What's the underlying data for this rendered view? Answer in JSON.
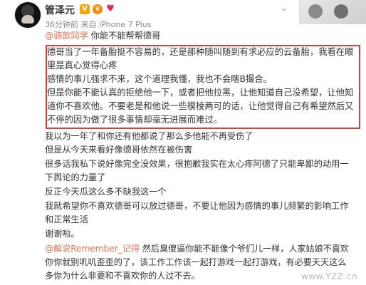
{
  "header": {
    "username": "管泽元",
    "meta": "36分钟前 来自 iPhone 7 Plus"
  },
  "post": {
    "mention_line": {
      "mention": "@骆歆同学",
      "text": " 你能不能帮帮德哥"
    },
    "boxed_paragraph": [
      "德哥当了一年备胎挺不容易的，还是那种随叫随到有求必应的云备胎，我看在眼",
      "里是真心觉得心疼",
      "感情的事儿强求不来，这个道理我懂，我也不会瞎B撮合。",
      "但是你能不能认真的拒绝他一下，或者把他拉黑，让他知道自己没希望，让他知",
      "道你不喜欢他。不要老是和他说一些模棱两可的话，让他觉得自己有希望然后又",
      "不停的因为做了很多事情却毫无进展而难过。"
    ],
    "lines": [
      "我以为一年了和你还有他都说了那么多他能不再受伤了",
      "但是从今天来看好像德哥依然在被伤害",
      "很多话我私下说好像完全没效果，很抱歉我实在太心疼阿德了只能卑鄙的动用一",
      "下舆论的力量了",
      "反正今天瓜这么多不缺我这一个",
      "我就希望你不喜欢德哥可以放过德哥，不要让他因为感情的事儿频繁的影响工作",
      "和正常生活",
      "谢谢啦。"
    ]
  },
  "reply": {
    "mention": "@解说Remember_记得",
    "lines": [
      " 然后臭傻逼你能不能像个爷们儿一样，人家姑娘不喜欢",
      "你你就别叽叽歪歪的了，该工作工作该一起打游戏一起打游戏，有必要天天这么",
      "多你为什么非要和不喜欢你的人过不去。"
    ]
  },
  "watermark": "www.YZZ.cn"
}
